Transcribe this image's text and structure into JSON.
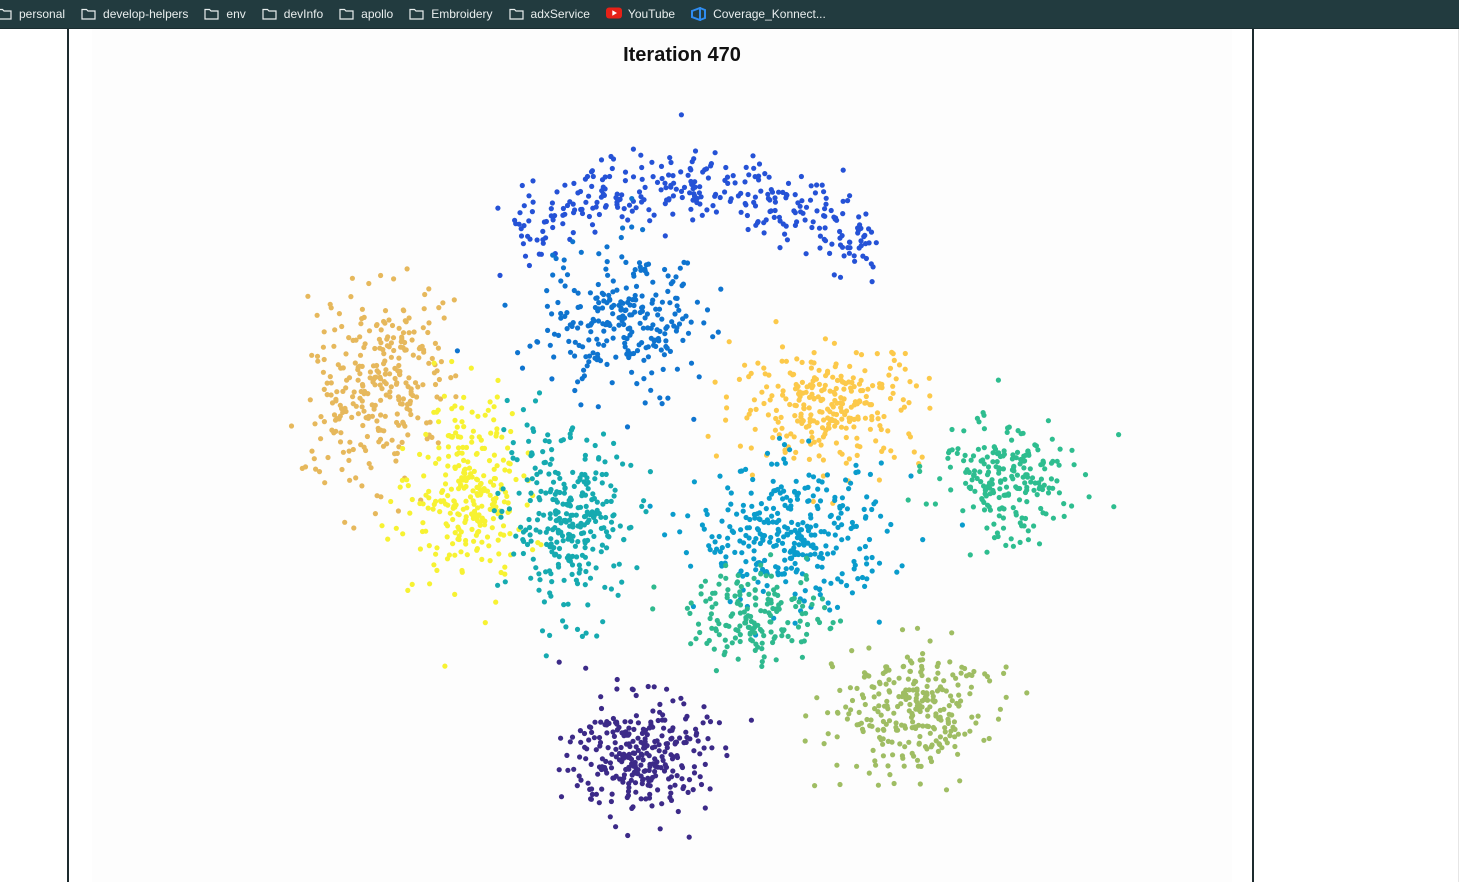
{
  "bookmarks": [
    {
      "label": "personal",
      "icon": "folder-icon"
    },
    {
      "label": "develop-helpers",
      "icon": "folder-icon"
    },
    {
      "label": "env",
      "icon": "folder-icon"
    },
    {
      "label": "devInfo",
      "icon": "folder-icon"
    },
    {
      "label": "apollo",
      "icon": "folder-icon"
    },
    {
      "label": "Embroidery",
      "icon": "folder-icon"
    },
    {
      "label": "adxService",
      "icon": "folder-icon"
    },
    {
      "label": "YouTube",
      "icon": "youtube-icon"
    },
    {
      "label": "Coverage_Konnect...",
      "icon": "azure-devops-icon"
    }
  ],
  "chart_data": {
    "type": "scatter",
    "title": "Iteration 470",
    "axes_visible": false,
    "grid": false,
    "legend": "none",
    "xlim": [
      0,
      100
    ],
    "ylim": [
      0,
      100
    ],
    "clusters": [
      {
        "color": "#2552d6",
        "center": [
          51,
          85
        ],
        "count": 330,
        "shape": "arc"
      },
      {
        "color": "#0f74cf",
        "center": [
          43,
          68
        ],
        "count": 270,
        "shape": "blob"
      },
      {
        "color": "#e6b85c",
        "center": [
          16,
          59
        ],
        "count": 300,
        "shape": "blob"
      },
      {
        "color": "#f7f232",
        "center": [
          26,
          46
        ],
        "count": 280,
        "shape": "blob"
      },
      {
        "color": "#16aab0",
        "center": [
          37,
          42
        ],
        "count": 300,
        "shape": "blob"
      },
      {
        "color": "#fcc94a",
        "center": [
          66,
          57
        ],
        "count": 280,
        "shape": "blob"
      },
      {
        "color": "#0a9ccc",
        "center": [
          62,
          40
        ],
        "count": 330,
        "shape": "blob"
      },
      {
        "color": "#2ebd8f",
        "center": [
          86,
          47
        ],
        "count": 220,
        "shape": "blob"
      },
      {
        "color": "#2fb98e",
        "center": [
          58,
          30
        ],
        "count": 170,
        "shape": "blob"
      },
      {
        "color": "#9fbd63",
        "center": [
          75,
          18
        ],
        "count": 280,
        "shape": "blob"
      },
      {
        "color": "#3c2a88",
        "center": [
          45,
          12
        ],
        "count": 300,
        "shape": "blob"
      }
    ]
  }
}
